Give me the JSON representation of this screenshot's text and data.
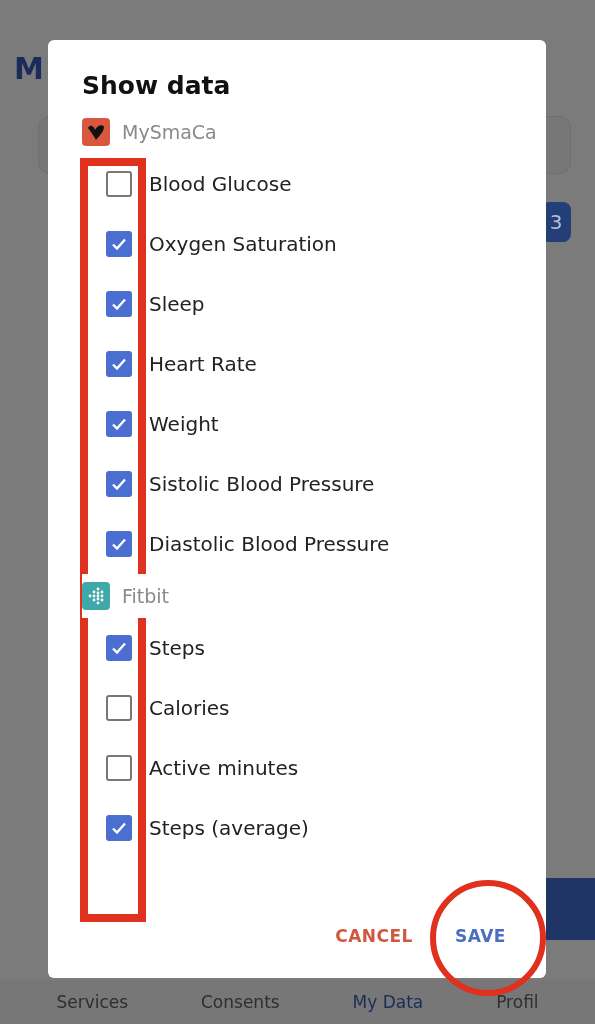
{
  "app": {
    "title": "M",
    "badge": "3",
    "nav": [
      {
        "label": "Services",
        "selected": false
      },
      {
        "label": "Consents",
        "selected": false
      },
      {
        "label": "My Data",
        "selected": true
      },
      {
        "label": "Profil",
        "selected": false
      }
    ]
  },
  "dialog": {
    "title": "Show data",
    "groups": [
      {
        "kind": "mysmaca",
        "name": "MySmaCa",
        "items": [
          {
            "label": "Blood Glucose",
            "checked": false
          },
          {
            "label": "Oxygen Saturation",
            "checked": true
          },
          {
            "label": "Sleep",
            "checked": true
          },
          {
            "label": "Heart Rate",
            "checked": true
          },
          {
            "label": "Weight",
            "checked": true
          },
          {
            "label": "Sistolic Blood Pressure",
            "checked": true
          },
          {
            "label": "Diastolic Blood Pressure",
            "checked": true
          }
        ]
      },
      {
        "kind": "fitbit",
        "name": "Fitbit",
        "items": [
          {
            "label": "Steps",
            "checked": true
          },
          {
            "label": "Calories",
            "checked": false
          },
          {
            "label": "Active minutes",
            "checked": false
          },
          {
            "label": "Steps (average)",
            "checked": true
          }
        ]
      }
    ],
    "buttons": [
      {
        "kind": "cancel",
        "label": "CANCEL"
      },
      {
        "kind": "save",
        "label": "SAVE"
      }
    ]
  },
  "annotations": [
    {
      "kind": "rectangle"
    },
    {
      "kind": "circle"
    }
  ]
}
